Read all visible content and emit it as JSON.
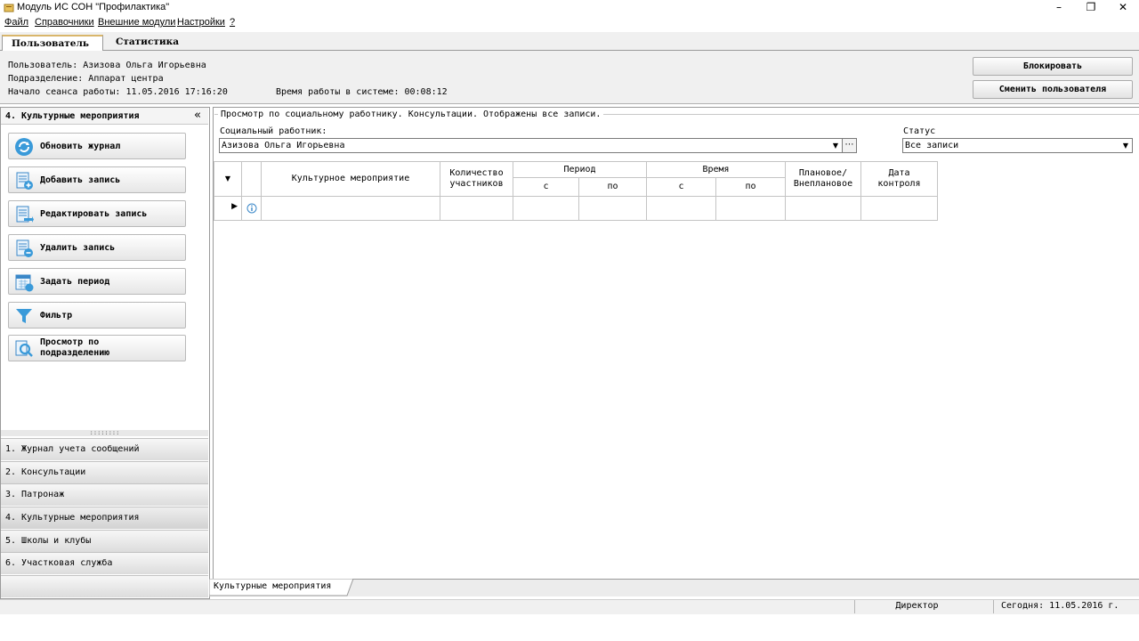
{
  "window": {
    "title": "Модуль ИС СОН \"Профилактика\"",
    "minimize_icon": "minimize-icon",
    "restore_icon": "restore-icon",
    "close_icon": "close-icon"
  },
  "menu": [
    "Файл",
    "Справочники",
    "Внешние модули",
    "Настройки",
    "?"
  ],
  "top_tabs": [
    "Пользователь",
    "Статистика"
  ],
  "user_info": {
    "user": "Пользователь: Азизова Ольга Игорьевна",
    "department": "Подразделение: Аппарат центра",
    "session_start": "Начало сеанса работы: 11.05.2016 17:16:20",
    "work_time": "Время работы в системе: 00:08:12",
    "block_button": "Блокировать",
    "switch_user_button": "Сменить пользователя"
  },
  "left_panel": {
    "header": "4. Культурные мероприятия",
    "actions": [
      {
        "label": "Обновить журнал",
        "icon": "refresh-icon"
      },
      {
        "label": "Добавить запись",
        "icon": "add-record-icon"
      },
      {
        "label": "Редактировать запись",
        "icon": "edit-record-icon"
      },
      {
        "label": "Удалить запись",
        "icon": "delete-record-icon"
      },
      {
        "label": "Задать период",
        "icon": "calendar-icon"
      },
      {
        "label": "Фильтр",
        "icon": "filter-icon"
      },
      {
        "label": "Просмотр по подразделению",
        "icon": "search-department-icon"
      }
    ],
    "nav": [
      "1. Журнал учета сообщений",
      "2. Консультации",
      "3. Патронаж",
      "4. Культурные мероприятия",
      "5. Школы и клубы",
      "6. Участковая служба"
    ]
  },
  "main": {
    "group_title": "Просмотр по социальному работнику. Консультации. Отображены все записи.",
    "worker_label": "Социальный работник:",
    "worker_value": "Азизова Ольга Игорьевна",
    "status_label": "Статус",
    "status_value": "Все записи",
    "grid": {
      "col_event": "Культурное мероприятие",
      "col_count_1": "Количество",
      "col_count_2": "участников",
      "col_period": "Период",
      "col_time": "Время",
      "sub_from": "с",
      "sub_to": "по",
      "col_plan_1": "Плановое/",
      "col_plan_2": "Внеплановое",
      "col_date_1": "Дата",
      "col_date_2": "контроля"
    },
    "bottom_tab": "Культурные мероприятия"
  },
  "statusbar": {
    "role": "Директор",
    "today": "Сегодня: 11.05.2016 г."
  }
}
